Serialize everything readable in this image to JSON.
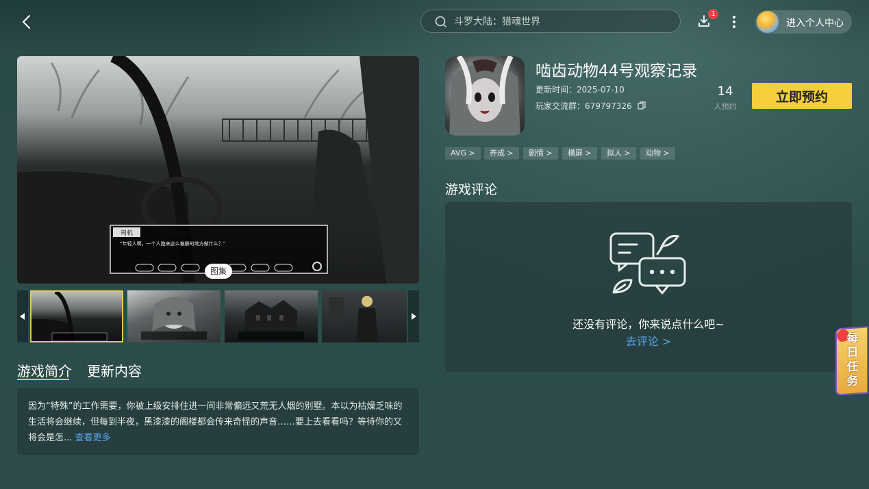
{
  "header": {
    "search_placeholder": "斗罗大陆：猎魂世界",
    "download_badge": "1",
    "profile_label": "进入个人中心"
  },
  "gallery": {
    "pill_label": "图集",
    "thumbnail_count": 4,
    "selected_index": 0
  },
  "game": {
    "title": "啮齿动物44号观察记录",
    "update_label": "更新时间：2025-07-10",
    "group_label": "玩家交流群：679797326",
    "reserve_count": "14",
    "reserve_count_label": "人预约",
    "reserve_button": "立即预约",
    "tags": [
      "AVG >",
      "养成 >",
      "剧情 >",
      "横屏 >",
      "拟人 >",
      "动物 >"
    ]
  },
  "tabs": {
    "intro": "游戏简介",
    "update": "更新内容"
  },
  "intro": {
    "text": "因为“特殊”的工作需要，你被上级安排住进一间非常偏远又荒无人烟的别墅。本以为枯燥乏味的生活将会继续，但每到半夜，黑漆漆的阁楼都会传来奇怪的声音……要上去看看吗？等待你的又将会是怎...",
    "more_link": "查看更多"
  },
  "reviews": {
    "heading": "游戏评论",
    "empty_text": "还没有评论，你来说点什么吧~",
    "go_link": "去评论 >"
  },
  "floating": {
    "daily_task": "每日任务"
  },
  "colors": {
    "accent_yellow": "#f5cf3c",
    "link_blue": "#5aa6ee",
    "badge_red": "#f04141"
  }
}
